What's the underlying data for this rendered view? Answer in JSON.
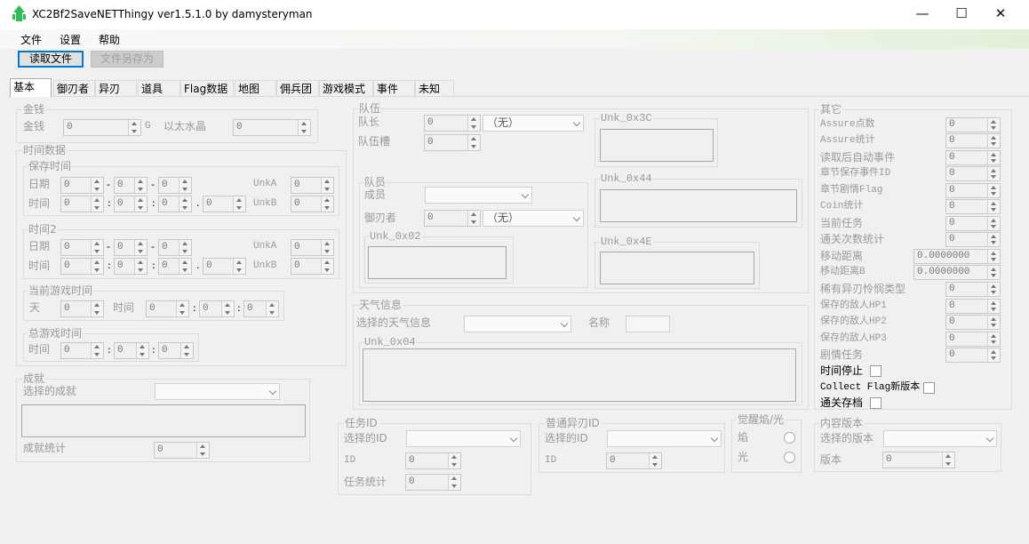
{
  "window": {
    "title": "XC2Bf2SaveNETThingy ver1.5.1.0 by damysteryman",
    "minimize": "—",
    "maximize": "☐",
    "close": "✕"
  },
  "menu": {
    "file": "文件",
    "settings": "设置",
    "help": "帮助"
  },
  "toolbar": {
    "read": "读取文件",
    "save_as": "文件另存为"
  },
  "tabs": [
    "基本",
    "御刃者",
    "异刃",
    "道具",
    "Flag数据",
    "地图",
    "佣兵团",
    "游戏模式",
    "事件",
    "未知"
  ],
  "money": {
    "group": "金钱",
    "label": "金钱",
    "value": "0",
    "unit": "G",
    "ether_label": "以太水晶",
    "ether_value": "0"
  },
  "time": {
    "group": "时间数据",
    "save": {
      "group": "保存时间",
      "date_label": "日期",
      "time_label": "时间",
      "unka": "UnkA",
      "unkb": "UnkB",
      "vals": [
        "0",
        "0",
        "0",
        "0",
        "0",
        "0",
        "0",
        "0",
        "0"
      ]
    },
    "time2": {
      "group": "时间2",
      "date_label": "日期",
      "time_label": "时间",
      "unka": "UnkA",
      "unkb": "UnkB",
      "vals": [
        "0",
        "0",
        "0",
        "0",
        "0",
        "0",
        "0",
        "0",
        "0"
      ]
    },
    "current": {
      "group": "当前游戏时间",
      "day_label": "天",
      "time_label": "时间",
      "vals": [
        "0",
        "0",
        "0",
        "0"
      ]
    },
    "total": {
      "group": "总游戏时间",
      "time_label": "时间",
      "vals": [
        "0",
        "0",
        "0"
      ]
    }
  },
  "achievements": {
    "group": "成就",
    "select_label": "选择的成就",
    "count_label": "成就统计",
    "count_value": "0"
  },
  "party": {
    "group": "队伍",
    "leader_label": "队长",
    "leader_value": "0",
    "leader_combo": "（无）",
    "slot_label": "队伍槽",
    "slot_value": "0",
    "unk3c": "Unk_0x3C",
    "unk44": "Unk_0x44",
    "unk4e": "Unk_0x4E",
    "member": {
      "group": "队员",
      "member_label": "成员",
      "driver_label": "御刃者",
      "driver_value": "0",
      "driver_combo": "（无）",
      "unk02": "Unk_0x02"
    }
  },
  "weather": {
    "group": "天气信息",
    "select_label": "选择的天气信息",
    "name_label": "名称",
    "unk04": "Unk_0x04"
  },
  "quest": {
    "group": "任务ID",
    "select_label": "选择的ID",
    "id_label": "ID",
    "id_value": "0",
    "count_label": "任务统计",
    "count_value": "0"
  },
  "common_blade": {
    "group": "普通异刃ID",
    "select_label": "选择的ID",
    "id_label": "ID",
    "id_value": "0"
  },
  "awaken": {
    "group": "觉醒焰/光",
    "fire": "焰",
    "light": "光"
  },
  "content": {
    "group": "内容版本",
    "select_label": "选择的版本",
    "ver_label": "版本",
    "ver_value": "0"
  },
  "other": {
    "group": "其它",
    "rows": [
      {
        "label": "Assure点数",
        "value": "0"
      },
      {
        "label": "Assure统计",
        "value": "0"
      },
      {
        "label": "读取后自动事件",
        "value": "0"
      },
      {
        "label": "章节保存事件ID",
        "value": "0"
      },
      {
        "label": "章节剧情Flag",
        "value": "0"
      },
      {
        "label": "Coin统计",
        "value": "0"
      },
      {
        "label": "当前任务",
        "value": "0"
      },
      {
        "label": "通关次数统计",
        "value": "0"
      },
      {
        "label": "移动距离",
        "value": "0.0000000"
      },
      {
        "label": "移动距离B",
        "value": "0.0000000"
      },
      {
        "label": "稀有异刃怜悯类型",
        "value": "0"
      },
      {
        "label": "保存的敌人HP1",
        "value": "0"
      },
      {
        "label": "保存的敌人HP2",
        "value": "0"
      },
      {
        "label": "保存的敌人HP3",
        "value": "0"
      },
      {
        "label": "剧情任务",
        "value": "0"
      }
    ],
    "checks": [
      "时间停止",
      "Collect Flag新版本",
      "通关存档"
    ]
  },
  "colors": {
    "accent": "#0078d7",
    "icon": "#2ebd59"
  }
}
